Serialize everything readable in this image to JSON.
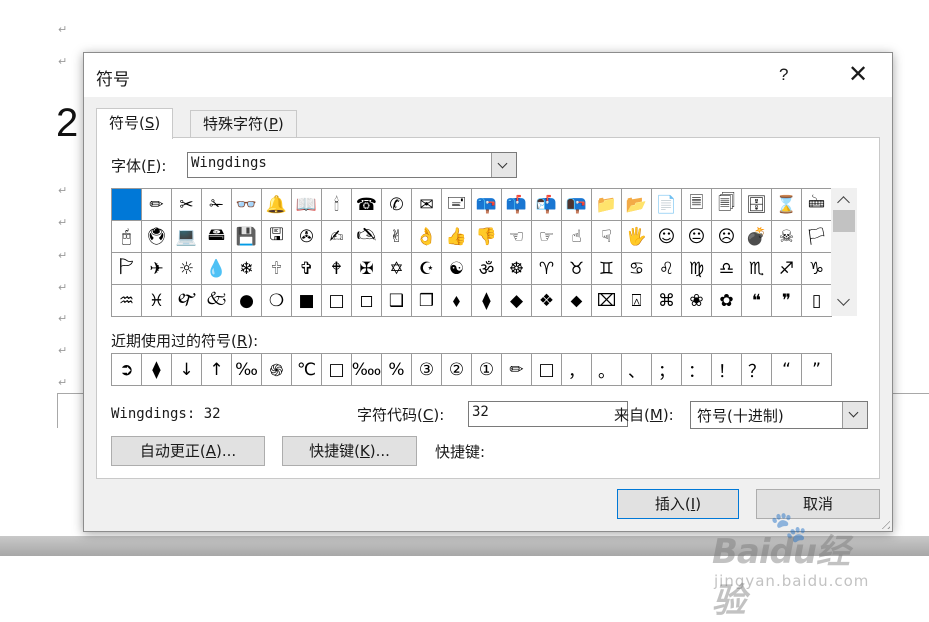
{
  "background_doc": {
    "big_digit": "2",
    "para_mark": "↵",
    "marks_top": [
      24,
      56,
      185,
      217,
      250,
      282,
      313,
      345,
      377
    ]
  },
  "watermark": {
    "main": "Baidu经验",
    "sub": "jingyan.baidu.com"
  },
  "dialog": {
    "title": "符号",
    "help_label": "?",
    "close_label": "✕",
    "tabs": [
      {
        "label": "符号(",
        "key": "S",
        "suffix": ")"
      },
      {
        "label": "特殊字符(",
        "key": "P",
        "suffix": ")"
      }
    ],
    "font_label": {
      "prefix": "字体(",
      "key": "F",
      "suffix": "):"
    },
    "font_value": "Wingdings",
    "symbol_grid": [
      [
        " ",
        "✏",
        "✂",
        "✁",
        "👓",
        "🔔",
        "📖",
        "🕯",
        "☎",
        "✆",
        "✉",
        "🖃",
        "📪",
        "📫",
        "📬",
        "📭",
        "📁",
        "📂",
        "📄",
        "🗏",
        "🗐",
        "🗄",
        "⌛",
        "🖮"
      ],
      [
        "🖰",
        "🖲",
        "💻",
        "🖴",
        "💾",
        "🖫",
        "✇",
        "✍",
        "🖎",
        "✌",
        "👌",
        "👍",
        "👎",
        "☜",
        "☞",
        "☝",
        "☟",
        "🖐",
        "☺",
        "😐",
        "☹",
        "💣",
        "☠",
        "🏳"
      ],
      [
        "🏱",
        "✈",
        "☼",
        "💧",
        "❄",
        "🕆",
        "✞",
        "🕈",
        "✠",
        "✡",
        "☪",
        "☯",
        "ॐ",
        "☸",
        "♈",
        "♉",
        "♊",
        "♋",
        "♌",
        "♍",
        "♎",
        "♏",
        "♐",
        "♑"
      ],
      [
        "♒",
        "♓",
        "🙰",
        "🙵",
        "●",
        "❍",
        "■",
        "□",
        "◻",
        "❑",
        "❒",
        "⬧",
        "⧫",
        "◆",
        "❖",
        "⬥",
        "⌧",
        "⍓",
        "⌘",
        "❀",
        "✿",
        "❝",
        "❞",
        "▯"
      ]
    ],
    "recent_label": {
      "prefix": "近期使用过的符号(",
      "key": "R",
      "suffix": "):"
    },
    "recent_symbols": [
      "➲",
      "⧫",
      "↓",
      "↑",
      "‰",
      "֍",
      "℃",
      "□",
      "‱",
      "%",
      "③",
      "②",
      "①",
      "✏",
      "□",
      "，",
      "。",
      "、",
      "；",
      "：",
      "！",
      "？",
      "“",
      "”"
    ],
    "font_info": "Wingdings: 32",
    "charcode_label": {
      "prefix": "字符代码(",
      "key": "C",
      "suffix": "):"
    },
    "charcode_value": "32",
    "from_label": {
      "prefix": "来自(",
      "key": "M",
      "suffix": "):"
    },
    "from_value": "符号(十进制)",
    "autocorrect_button": {
      "prefix": "自动更正(",
      "key": "A",
      "suffix": ")..."
    },
    "shortcut_button": {
      "prefix": "快捷键(",
      "key": "K",
      "suffix": ")..."
    },
    "shortcut_label": "快捷键:",
    "insert_button": {
      "prefix": "插入(",
      "key": "I",
      "suffix": ")"
    },
    "cancel_button": "取消",
    "colors": {
      "selection": "#0078d7",
      "dialog_bg": "#f0f0f0"
    }
  }
}
